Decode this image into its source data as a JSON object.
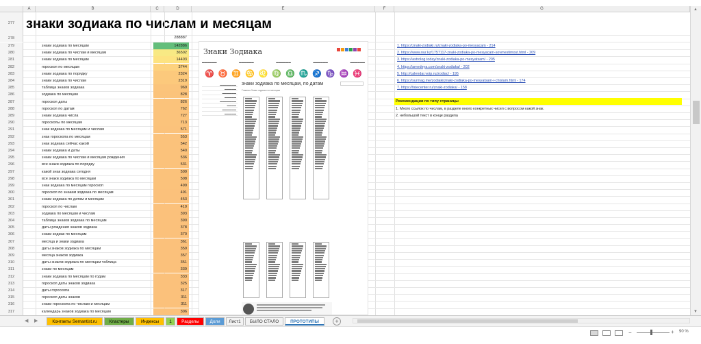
{
  "columns": [
    "A",
    "B",
    "C",
    "D",
    "E",
    "F",
    "G"
  ],
  "title": "знаки зодиака по числам и месяцам",
  "title_row": "277",
  "total_row": "278",
  "total_value": "288887",
  "keywords": [
    {
      "row": "279",
      "text": "знаки зодиака по месяцам",
      "value": "142886",
      "color": "#63be7b"
    },
    {
      "row": "280",
      "text": "знаки зодиака по числам и месяцам",
      "value": "36502",
      "color": "#f8e984"
    },
    {
      "row": "281",
      "text": "знаки зодиака по месяцам",
      "value": "14403",
      "color": "#fde381"
    },
    {
      "row": "282",
      "text": "гороскоп по месяцам",
      "value": "3744",
      "color": "#fdd27e"
    },
    {
      "row": "283",
      "text": "знаки зодиака по порядку",
      "value": "2324",
      "color": "#fcc97c"
    },
    {
      "row": "284",
      "text": "знаки зодиака по числам",
      "value": "2319",
      "color": "#fcc97c"
    },
    {
      "row": "285",
      "text": "таблица знаков зодиака",
      "value": "969",
      "color": "#fbc47b"
    },
    {
      "row": "286",
      "text": "зодиака по месяцам",
      "value": "828",
      "color": "#fbc37b"
    },
    {
      "row": "287",
      "text": "гороскоп даты",
      "value": "826",
      "color": "#fbc37b"
    },
    {
      "row": "288",
      "text": "гороскоп по датам",
      "value": "762",
      "color": "#fbc37b"
    },
    {
      "row": "289",
      "text": "знаки зодиака числа",
      "value": "727",
      "color": "#fbc37b"
    },
    {
      "row": "290",
      "text": "гороскопы по месяцам",
      "value": "713",
      "color": "#fbc37b"
    },
    {
      "row": "291",
      "text": "знак зодиака по месяцам и числам",
      "value": "571",
      "color": "#fbc27b"
    },
    {
      "row": "292",
      "text": "знак гороскопа по месяцам",
      "value": "553",
      "color": "#fbc27b"
    },
    {
      "row": "293",
      "text": "знак зодиака сейчас какой",
      "value": "542",
      "color": "#fbc27b"
    },
    {
      "row": "294",
      "text": "знаки зодиака и даты",
      "value": "540",
      "color": "#fbc27b"
    },
    {
      "row": "295",
      "text": "знаки зодиака по числам и месяцам рождения",
      "value": "536",
      "color": "#fbc27b"
    },
    {
      "row": "296",
      "text": "все знаки зодиака по порядку",
      "value": "531",
      "color": "#fbc27b"
    },
    {
      "row": "297",
      "text": "какой знак зодиака сегодня",
      "value": "509",
      "color": "#fbc27b"
    },
    {
      "row": "298",
      "text": "все знаки зодиака по месяцам",
      "value": "508",
      "color": "#fbc27b"
    },
    {
      "row": "299",
      "text": "знак зодиака по месяцам гороскоп",
      "value": "499",
      "color": "#fbc27b"
    },
    {
      "row": "300",
      "text": "гороскоп по знакам зодиака по месяцам",
      "value": "491",
      "color": "#fbc17b"
    },
    {
      "row": "301",
      "text": "знаки зодиака по датам и месяцам",
      "value": "453",
      "color": "#fbc17b"
    },
    {
      "row": "302",
      "text": "гороскоп по числам",
      "value": "419",
      "color": "#fbc17b"
    },
    {
      "row": "303",
      "text": "зодиака по месяцам и числам",
      "value": "393",
      "color": "#fbc17b"
    },
    {
      "row": "304",
      "text": "таблица знаков зодиака по месяцам",
      "value": "390",
      "color": "#fbc17b"
    },
    {
      "row": "305",
      "text": "даты рождения знаков зодиака",
      "value": "378",
      "color": "#fbc17b"
    },
    {
      "row": "306",
      "text": "знаки зодиак по месяцам",
      "value": "370",
      "color": "#fbc17b"
    },
    {
      "row": "307",
      "text": "месяца и знаки зодиака",
      "value": "361",
      "color": "#fbc17b"
    },
    {
      "row": "308",
      "text": "даты знаков зодиака по месяцам",
      "value": "359",
      "color": "#fbc17b"
    },
    {
      "row": "309",
      "text": "месяца знаков зодиака",
      "value": "357",
      "color": "#fbc17b"
    },
    {
      "row": "310",
      "text": "даты знаков зодиака по месяцам таблица",
      "value": "351",
      "color": "#fbc17b"
    },
    {
      "row": "311",
      "text": "знаки по месяцам",
      "value": "339",
      "color": "#fbc17b"
    },
    {
      "row": "312",
      "text": "знаки зодиака по месяцам по годам",
      "value": "333",
      "color": "#fbc17b"
    },
    {
      "row": "313",
      "text": "гороскоп даты знаков зодиака",
      "value": "325",
      "color": "#fbc17b"
    },
    {
      "row": "314",
      "text": "даты гороскопа",
      "value": "317",
      "color": "#fbc17b"
    },
    {
      "row": "315",
      "text": "гороскоп даты знаков",
      "value": "311",
      "color": "#fbc17b"
    },
    {
      "row": "316",
      "text": "знаки гороскопа по числам и месяцам",
      "value": "311",
      "color": "#fbc17b"
    },
    {
      "row": "317",
      "text": "календарь знаков зодиака по месяцам",
      "value": "306",
      "color": "#fbc17b"
    }
  ],
  "prototype": {
    "logo": "Знаки Зодиака",
    "page_title": "знаки зодиака по месяцам, по датам",
    "subtitle": "Главная  Знаки зодиака по месяцам"
  },
  "links": [
    "1. https://znaki-zodiaki.ru/znaki-zodiaka-po-mesyacam - 214",
    "2. https://www.nur.kz/1757117-znaki-zodiaka-po-mesyacam-sovmestimost.html - 209",
    "3. https://astrolog.today/znaki-zodiaka-po-mesyatsam/ - 205",
    "4. https://amedeya.com/znaki-zodiaka/ - 202",
    "5. http://calendar.voip.ru/zodiac/ - 195",
    "6. https://surmag.me/zodiaki/znaki-zodiaka-po-mesyatsam-i-chislam.html - 174",
    "7. https://fatecenter.ru/znaki-zodiaka/ - 158"
  ],
  "recommendations": {
    "header": "Рекомендации по типу страницы",
    "items": [
      "1. Много ссылок по числам, в разделе много конкретных чисел с вопросом какой знак.",
      "2. небольшой текст в конце раздела"
    ]
  },
  "tabs": [
    {
      "label": "Контакты Semantist.ru",
      "bg": "#ffc000",
      "color": "#000"
    },
    {
      "label": "Кластеры",
      "bg": "#70ad47",
      "color": "#000"
    },
    {
      "label": "Индексы",
      "bg": "#ffc000",
      "color": "#000"
    },
    {
      "label": "1",
      "bg": "#92d050",
      "color": "#000"
    },
    {
      "label": "Разделы",
      "bg": "#ff0000",
      "color": "#fff"
    },
    {
      "label": "Доли",
      "bg": "#5b9bd5",
      "color": "#fff"
    },
    {
      "label": "Лист1",
      "bg": "#f3f3f3",
      "color": "#333"
    },
    {
      "label": "БЫЛО СТАЛО",
      "bg": "#f3f3f3",
      "color": "#333"
    },
    {
      "label": "ПРОТОТИПЫ",
      "bg": "#ffffff",
      "color": "#2e75b6"
    }
  ],
  "zoom_label": "90 %",
  "zoom_value": 90
}
